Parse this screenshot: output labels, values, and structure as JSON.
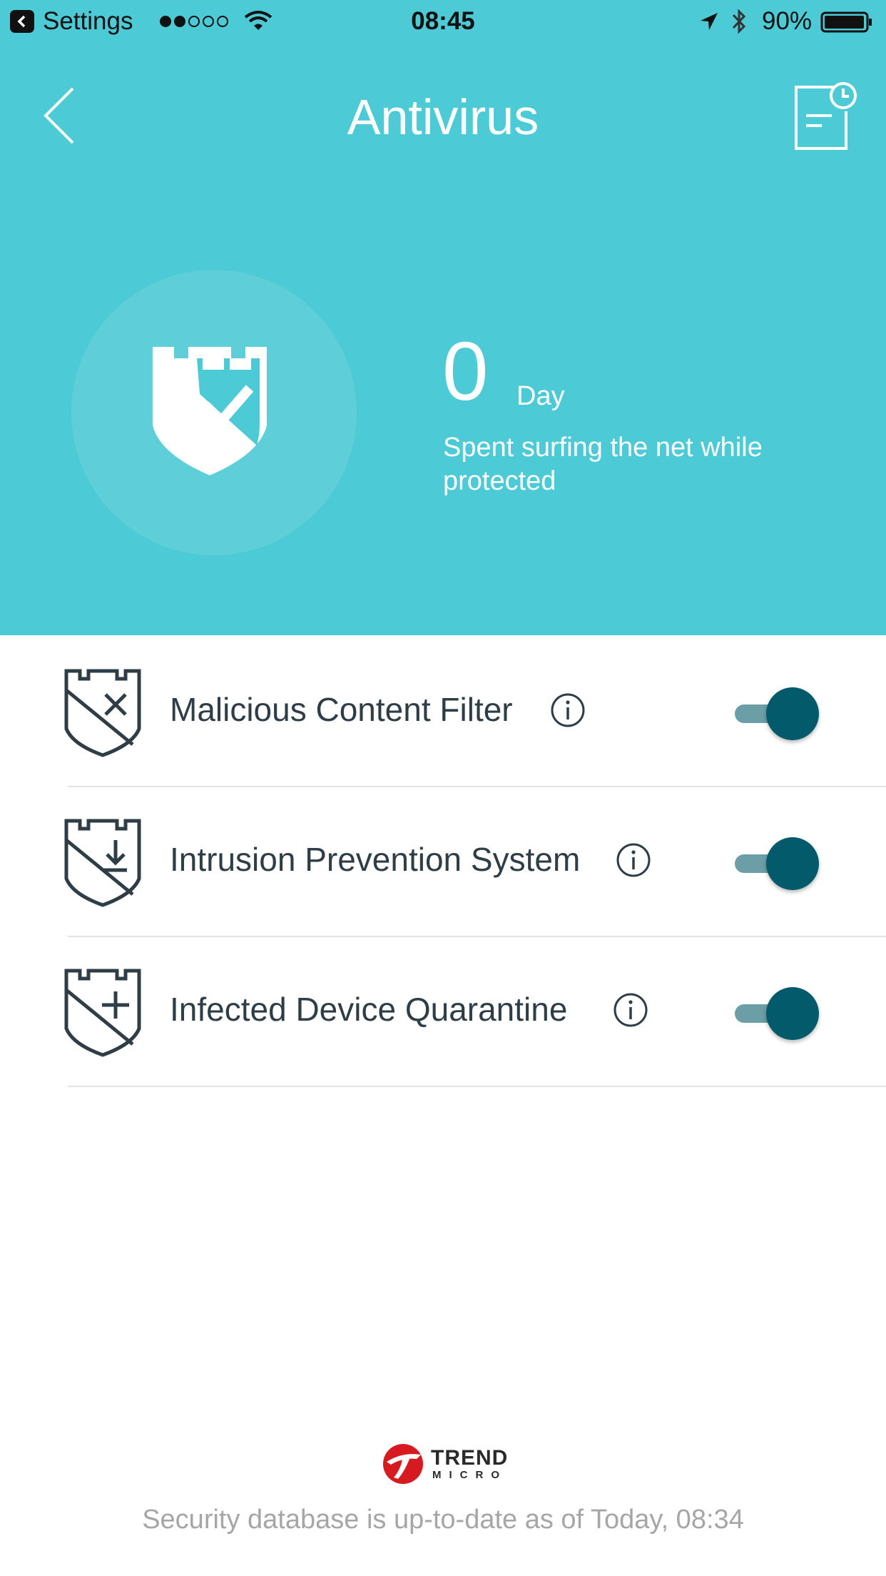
{
  "status_bar": {
    "app_name": "Settings",
    "time": "08:45",
    "battery": "90%"
  },
  "header": {
    "title": "Antivirus"
  },
  "summary": {
    "days": "0",
    "unit": "Day",
    "description": "Spent surfing the net while protected"
  },
  "features": [
    {
      "label": "Malicious Content Filter",
      "enabled": true,
      "icon": "shield-x-icon"
    },
    {
      "label": "Intrusion Prevention System",
      "enabled": true,
      "icon": "shield-download-icon"
    },
    {
      "label": "Infected Device Quarantine",
      "enabled": true,
      "icon": "shield-plus-icon"
    }
  ],
  "footer": {
    "brand_line1": "TREND",
    "brand_line2": "MICRO",
    "update_text": "Security database is up-to-date as of Today, 08:34"
  },
  "colors": {
    "header_bg": "#4ccad5",
    "toggle_on": "#035a6a",
    "text_dark": "#2f3e46",
    "brand_red": "#d71920"
  }
}
